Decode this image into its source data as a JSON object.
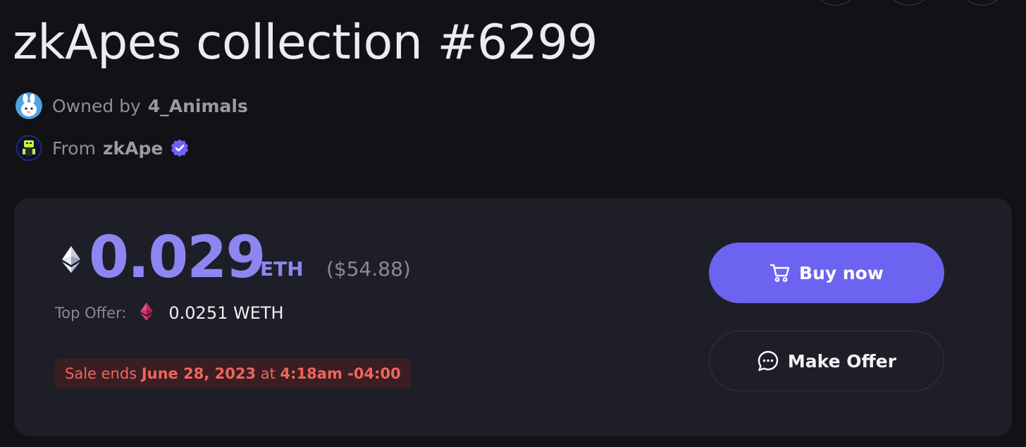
{
  "nft": {
    "title": "zkApes collection #6299",
    "owner_label": "Owned by",
    "owner_name": "4_Animals",
    "collection_label": "From",
    "collection_name": "zkApe"
  },
  "listing": {
    "price": "0.029",
    "currency": "ETH",
    "price_usd": "($54.88)",
    "top_offer_label": "Top Offer:",
    "top_offer_value": "0.0251 WETH",
    "sale_prefix": "Sale ends",
    "sale_date": "June 28, 2023",
    "sale_at": "at",
    "sale_time": "4:18am -04:00"
  },
  "actions": {
    "buy_label": "Buy now",
    "offer_label": "Make Offer"
  },
  "icons": {
    "owner_avatar": "bunny-avatar-icon",
    "collection_avatar": "zkape-avatar-icon",
    "verified": "verified-badge-icon",
    "eth": "ethereum-icon",
    "weth": "weth-icon",
    "cart": "cart-icon",
    "chat": "chat-bubble-icon"
  },
  "colors": {
    "accent": "#6c63f0",
    "price": "#8d86f2",
    "sale_text": "#f0645f",
    "sale_bg": "#3a1e22",
    "card_bg": "#1e1e28",
    "page_bg": "#111116"
  }
}
